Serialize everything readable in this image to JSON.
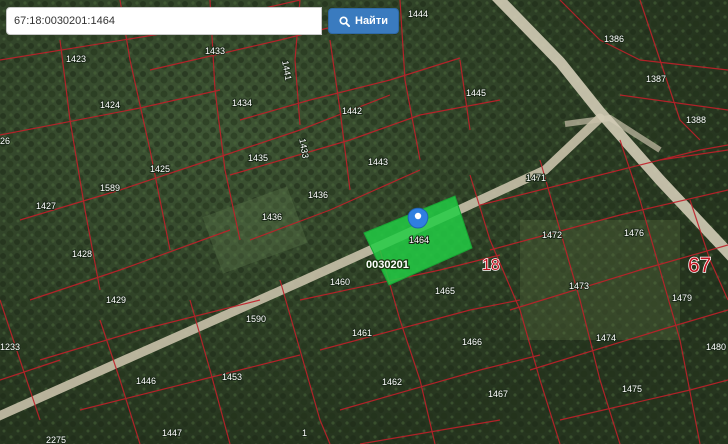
{
  "search": {
    "value": "67:18:0030201:1464",
    "button_label": "Найти",
    "button_icon": "search-icon"
  },
  "map": {
    "selected_parcel": "1464",
    "quarter_label": "0030201",
    "block_labels": [
      "18",
      "67"
    ],
    "parcels": [
      "1423",
      "1424",
      "1425",
      "1427",
      "1428",
      "1429",
      "1433",
      "1434",
      "1435",
      "1436",
      "1441",
      "1442",
      "1443",
      "1444",
      "1445",
      "1433",
      "1446",
      "1447",
      "1453",
      "1460",
      "1461",
      "1462",
      "1465",
      "1466",
      "1467",
      "1471",
      "1472",
      "1473",
      "1474",
      "1475",
      "1476",
      "1479",
      "1480",
      "1386",
      "1387",
      "1388",
      "1589",
      "1590",
      "1233",
      "2275",
      "26",
      "1"
    ],
    "colors": {
      "cadastral_line": "#c0202a",
      "selected_fill": "#22cc44",
      "road": "#c9c1aa",
      "marker": "#2f7fe0"
    }
  }
}
